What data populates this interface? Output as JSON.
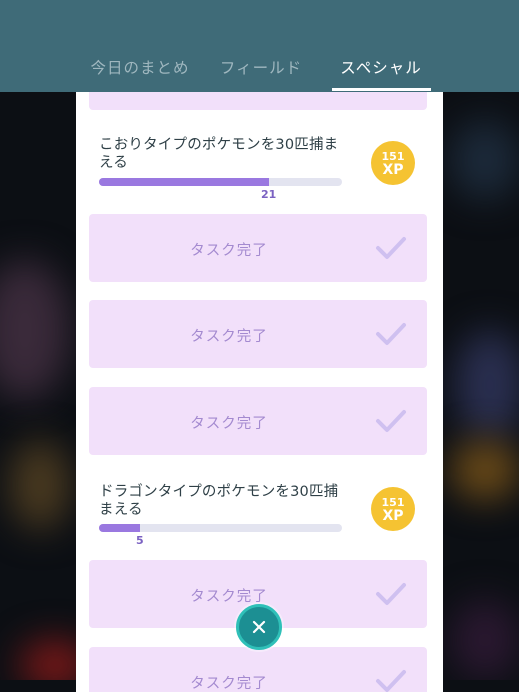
{
  "tabs": [
    {
      "label": "今日のまとめ",
      "active": false
    },
    {
      "label": "フィールド",
      "active": false
    },
    {
      "label": "スペシャル",
      "active": true
    }
  ],
  "tasks": [
    {
      "title": "こおりタイプのポケモンを30匹捕まえる",
      "progress_value": "21",
      "progress_fraction": 0.7,
      "reward_amount": "151",
      "reward_unit": "XP"
    },
    {
      "title": "ドラゴンタイプのポケモンを30匹捕まえる",
      "progress_value": "5",
      "progress_fraction": 0.167,
      "reward_amount": "151",
      "reward_unit": "XP"
    }
  ],
  "completed_label": "タスク完了",
  "icons": {
    "check": "check-icon",
    "close": "close-icon"
  },
  "colors": {
    "header": "#3f6b78",
    "card": "#f2e0fa",
    "progress": "#9a78e0",
    "reward": "#f5c332",
    "close_button": "#1c8f93"
  }
}
